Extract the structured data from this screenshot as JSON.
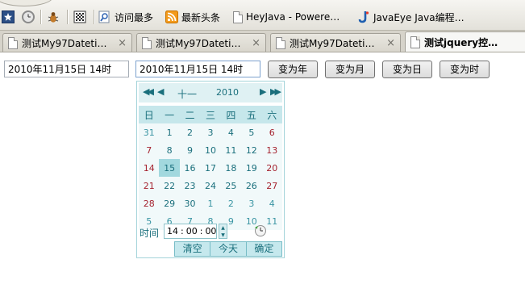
{
  "bookmarks": {
    "items": [
      {
        "label": "访问最多"
      },
      {
        "label": "最新头条"
      },
      {
        "label": "HeyJava - Powere…"
      },
      {
        "label": "JavaEye Java编程…"
      }
    ]
  },
  "tabs": [
    {
      "label": "测试My97Dateti…",
      "active": false
    },
    {
      "label": "测试My97Dateti…",
      "active": false
    },
    {
      "label": "测试My97Dateti…",
      "active": false
    },
    {
      "label": "测试jquery控…",
      "active": true
    }
  ],
  "tab_close_glyph": "×",
  "inputs": {
    "first_value": "2010年11月15日 14时",
    "second_value": "2010年11月15日 14时"
  },
  "buttons": {
    "to_year": "变为年",
    "to_month": "变为月",
    "to_day": "变为日",
    "to_hour": "变为时"
  },
  "picker": {
    "month": "十一",
    "year": "2010",
    "nav": {
      "prev_year": "◀◀",
      "prev_month": "◀",
      "next_month": "▶",
      "next_year": "▶▶"
    },
    "weekdays": [
      "日",
      "一",
      "二",
      "三",
      "四",
      "五",
      "六"
    ],
    "weeks": [
      [
        "31",
        "1",
        "2",
        "3",
        "4",
        "5",
        "6"
      ],
      [
        "7",
        "8",
        "9",
        "10",
        "11",
        "12",
        "13"
      ],
      [
        "14",
        "15",
        "16",
        "17",
        "18",
        "19",
        "20"
      ],
      [
        "21",
        "22",
        "23",
        "24",
        "25",
        "26",
        "27"
      ],
      [
        "28",
        "29",
        "30",
        "1",
        "2",
        "3",
        "4"
      ],
      [
        "5",
        "6",
        "7",
        "8",
        "9",
        "10",
        "11"
      ]
    ],
    "selected_day": "15",
    "time_label": "时间",
    "time": {
      "hour": "14",
      "minute": "00",
      "second": "00",
      "sep": ":"
    },
    "clear_label": "清空",
    "today_label": "今天",
    "ok_label": "确定"
  },
  "colors": {
    "picker_text": "#1a6f7c",
    "picker_header": "#dff1f3",
    "picker_weekday_bg": "#c6e7eb",
    "picker_selected": "#a2d8de",
    "weekend": "#a5232f"
  }
}
